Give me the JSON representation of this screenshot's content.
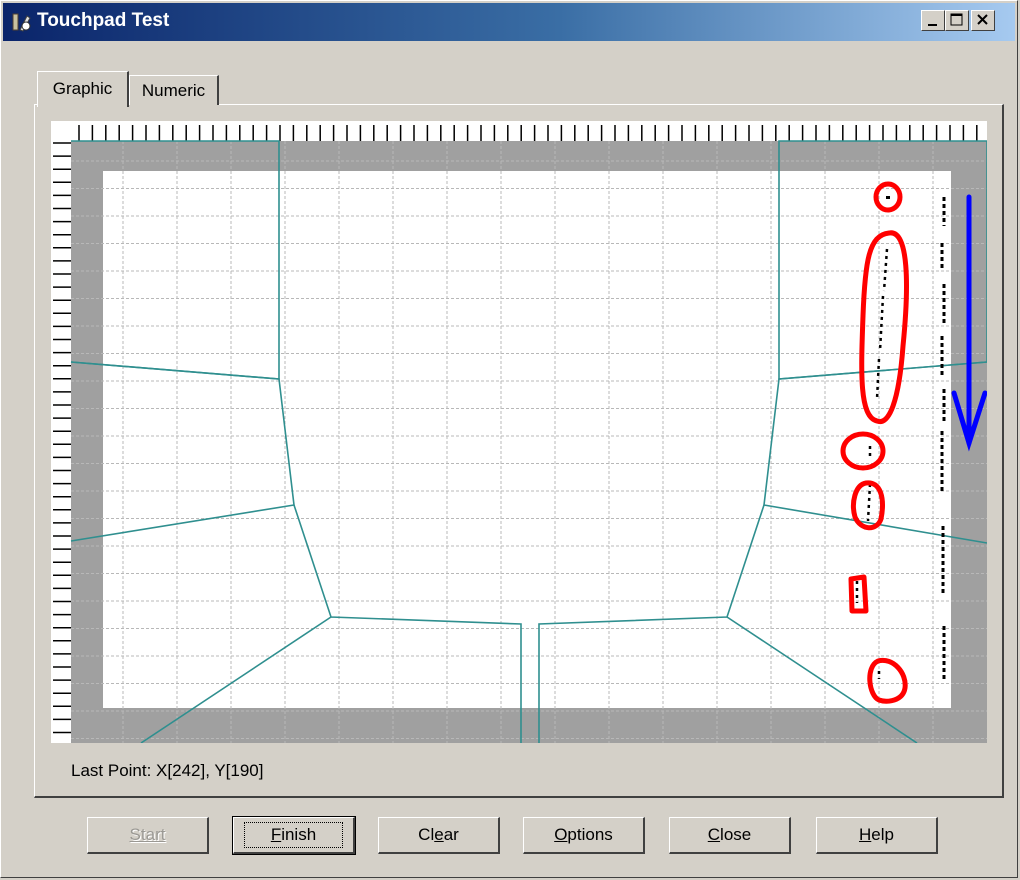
{
  "window": {
    "title": "Touchpad Test",
    "controls": {
      "minimize": "minimize-icon",
      "maximize": "maximize-icon",
      "close": "close-icon"
    }
  },
  "tabs": [
    {
      "label": "Graphic",
      "selected": true
    },
    {
      "label": "Numeric",
      "selected": false
    }
  ],
  "plot": {
    "colors": {
      "frame": "#a0a0a0",
      "surface": "#ffffff",
      "grid": "#b8b8b8",
      "zones": "#2f8f8f",
      "trace": "#000000",
      "annotation_circles": "#ff0000",
      "annotation_arrow": "#0000ff"
    }
  },
  "status": {
    "last_point": "Last Point: X[242], Y[190]"
  },
  "buttons": {
    "start": {
      "label": "Start",
      "mnemonic": "S",
      "enabled": false
    },
    "finish": {
      "label": "Finish",
      "mnemonic": "F",
      "enabled": true,
      "focused": true
    },
    "clear": {
      "label": "Clear",
      "mnemonic": "e",
      "enabled": true
    },
    "options": {
      "label": "Options",
      "mnemonic": "O",
      "enabled": true
    },
    "close": {
      "label": "Close",
      "mnemonic": "C",
      "enabled": true
    },
    "help": {
      "label": "Help",
      "mnemonic": "H",
      "enabled": true
    }
  }
}
